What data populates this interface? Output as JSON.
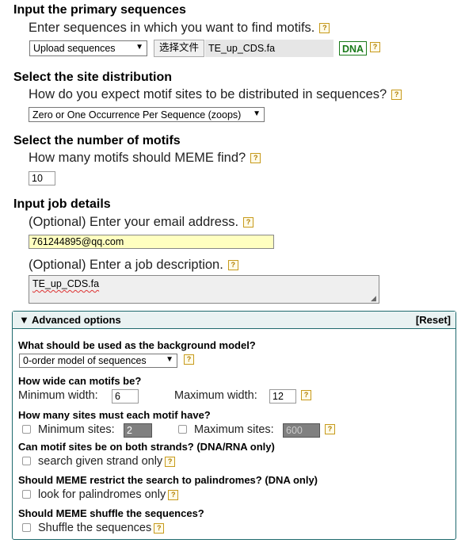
{
  "primary": {
    "title": "Input the primary sequences",
    "question": "Enter sequences in which you want to find motifs.",
    "input_select": "Upload sequences",
    "choose_file_label": "选择文件",
    "file_name": "TE_up_CDS.fa",
    "alphabet_badge": "DNA"
  },
  "site_dist": {
    "title": "Select the site distribution",
    "question": "How do you expect motif sites to be distributed in sequences?",
    "select": "Zero or One Occurrence Per Sequence (zoops)"
  },
  "motif_num": {
    "title": "Select the number of motifs",
    "question": "How many motifs should MEME find?",
    "value": "10"
  },
  "job": {
    "title": "Input job details",
    "email_question": "(Optional) Enter your email address.",
    "email_value": "761244895@qq.com",
    "desc_question": "(Optional) Enter a job description.",
    "desc_value": "TE_up_CDS.fa"
  },
  "advanced": {
    "header": "▼ Advanced options",
    "reset": "[Reset]",
    "background_q": "What should be used as the background model?",
    "background_select": "0-order model of sequences",
    "width_q": "How wide can motifs be?",
    "min_width_label": "Minimum width:",
    "min_width_value": "6",
    "max_width_label": "Maximum width:",
    "max_width_value": "12",
    "sites_q": "How many sites must each motif have?",
    "min_sites_label": "Minimum sites:",
    "min_sites_value": "2",
    "max_sites_label": "Maximum sites:",
    "max_sites_value": "600",
    "strands_q": "Can motif sites be on both strands? (DNA/RNA only)",
    "strands_opt": "search given strand only",
    "pal_q": "Should MEME restrict the search to palindromes? (DNA only)",
    "pal_opt": "look for palindromes only",
    "shuffle_q": "Should MEME shuffle the sequences?",
    "shuffle_opt": "Shuffle the sequences"
  },
  "colors": {
    "help_border": "#c79a1c",
    "dna_green": "#1a7a1a",
    "email_bg": "#ffffc0",
    "panel_border": "#1f6a6e",
    "disabled_input": "#808080"
  }
}
